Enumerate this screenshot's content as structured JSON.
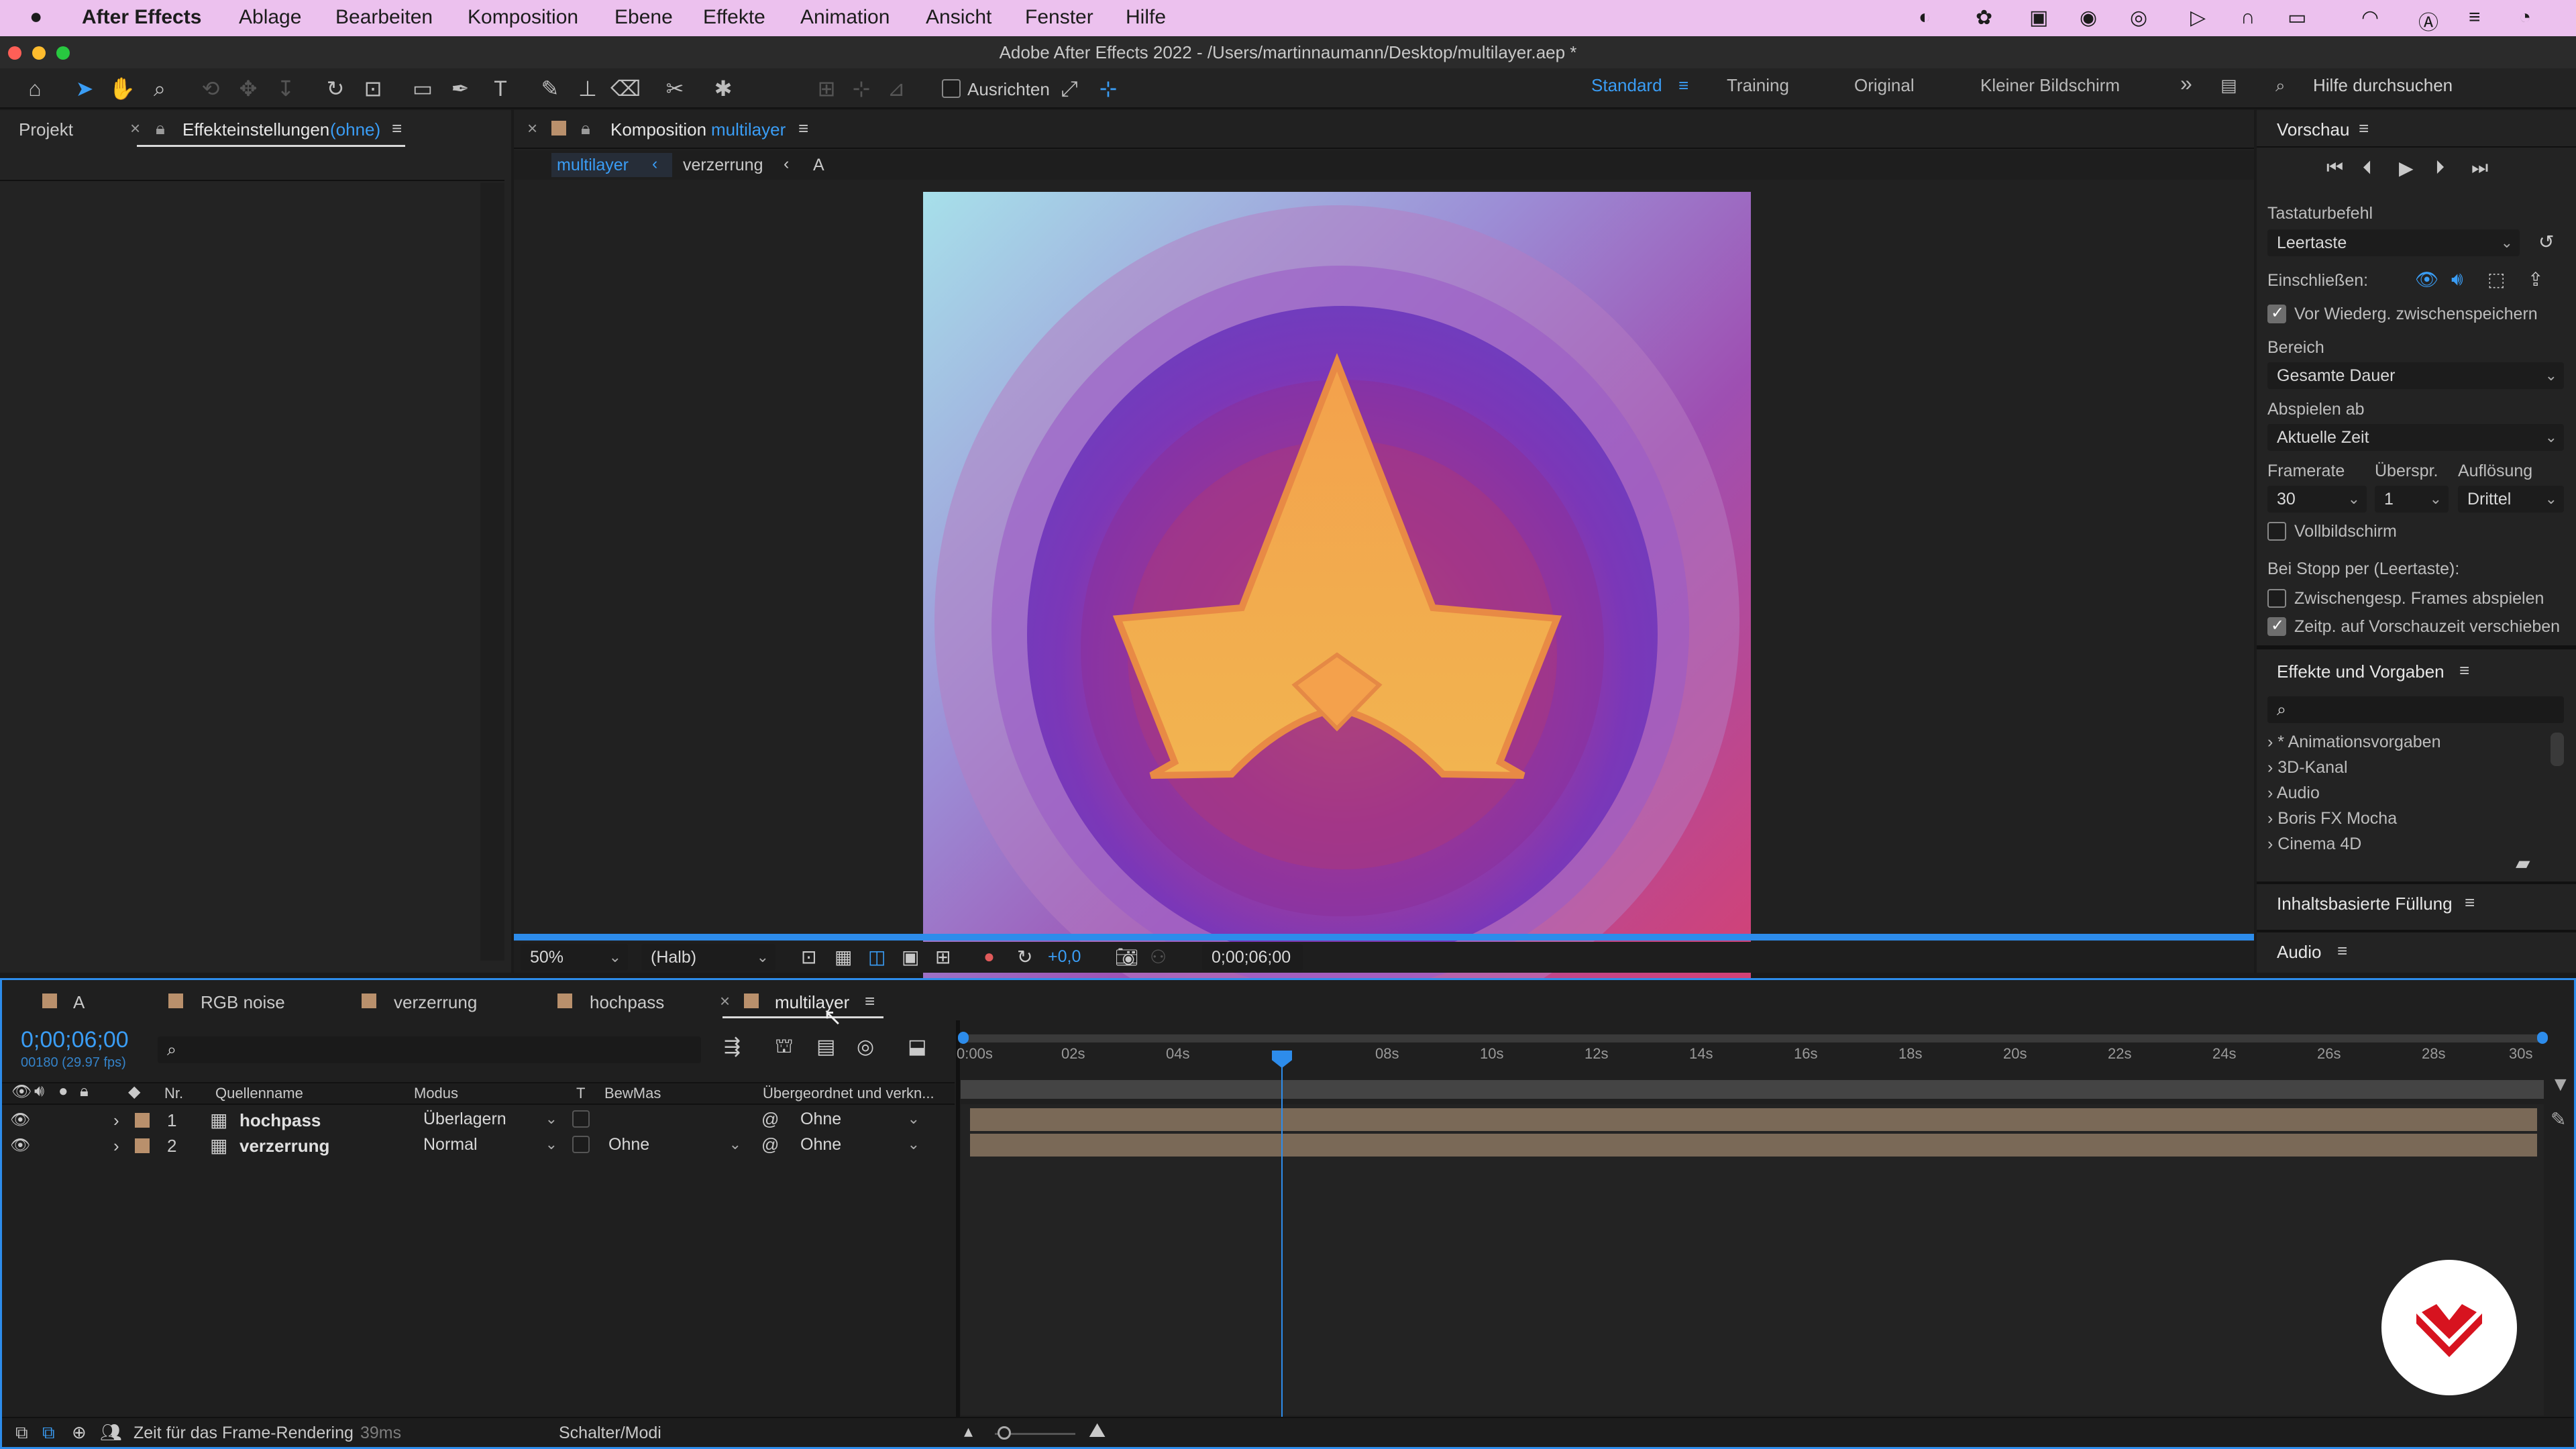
{
  "menubar": {
    "apple": "",
    "app": "After Effects",
    "items": [
      "Ablage",
      "Bearbeiten",
      "Komposition",
      "Ebene",
      "Effekte",
      "Animation",
      "Ansicht",
      "Fenster",
      "Hilfe"
    ]
  },
  "window_title": "Adobe After Effects 2022 - /Users/martinnaumann/Desktop/multilayer.aep *",
  "toolbar": {
    "ausrichten": "Ausrichten",
    "workspaces": [
      "Standard",
      "Training",
      "Original",
      "Kleiner Bildschirm"
    ],
    "active_workspace": "Standard",
    "search_placeholder": "Hilfe durchsuchen"
  },
  "left_panel": {
    "tab_projekt": "Projekt",
    "tab_effekt": "Effekteinstellungen",
    "tab_effekt_sub": "(ohne)"
  },
  "comp_panel": {
    "tab_prefix": "Komposition",
    "tab_name": "multilayer",
    "breadcrumbs": [
      "multilayer",
      "verzerrung",
      "A"
    ],
    "zoom": "50%",
    "resolution": "(Halb)",
    "exposure": "+0,0",
    "timecode": "0;00;06;00"
  },
  "preview": {
    "title": "Vorschau",
    "shortcut_label": "Tastaturbefehl",
    "shortcut_value": "Leertaste",
    "include_label": "Einschließen:",
    "cache_label": "Vor Wiederg. zwischenspeichern",
    "range_label": "Bereich",
    "range_value": "Gesamte Dauer",
    "play_from_label": "Abspielen ab",
    "play_from_value": "Aktuelle Zeit",
    "framerate_label": "Framerate",
    "skip_label": "Überspr.",
    "resolution_label": "Auflösung",
    "framerate_value": "30",
    "skip_value": "1",
    "resolution_value": "Drittel",
    "fullscreen_label": "Vollbildschirm",
    "stop_label": "Bei Stopp per (Leertaste):",
    "cached_frames_label": "Zwischengesp. Frames abspielen",
    "move_time_label": "Zeitp. auf Vorschauzeit verschieben"
  },
  "effects": {
    "title": "Effekte und Vorgaben",
    "search_placeholder": "",
    "items": [
      "* Animationsvorgaben",
      "3D-Kanal",
      "Audio",
      "Boris FX Mocha",
      "Cinema 4D"
    ]
  },
  "content_fill": {
    "title": "Inhaltsbasierte Füllung"
  },
  "audio_panel": {
    "title": "Audio"
  },
  "timeline": {
    "tabs": [
      "A",
      "RGB noise",
      "verzerrung",
      "hochpass",
      "multilayer"
    ],
    "active_tab": "multilayer",
    "timecode": "0;00;06;00",
    "frame_info": "00180 (29.97 fps)",
    "col_nr": "Nr.",
    "col_source": "Quellenname",
    "col_mode": "Modus",
    "col_t": "T",
    "col_trkmat": "BewMas",
    "col_parent": "Übergeordnet und verkn...",
    "ruler": [
      "0:00s",
      "02s",
      "04s",
      "06s",
      "08s",
      "10s",
      "12s",
      "14s",
      "16s",
      "18s",
      "20s",
      "22s",
      "24s",
      "26s",
      "28s",
      "30s"
    ],
    "layers": [
      {
        "nr": "1",
        "name": "hochpass",
        "mode": "Überlagern",
        "trkmat": "",
        "parent": "Ohne"
      },
      {
        "nr": "2",
        "name": "verzerrung",
        "mode": "Normal",
        "trkmat": "Ohne",
        "parent": "Ohne"
      }
    ],
    "render_time_label": "Zeit für das Frame-Rendering",
    "render_time_value": "39ms",
    "switches_label": "Schalter/Modi"
  },
  "colors": {
    "accent": "#2d8ceb",
    "menubar": "#ecc1ee",
    "layer_bar": "#7a6957",
    "label_tan": "#b9906c",
    "logo_red": "#d7131f"
  }
}
